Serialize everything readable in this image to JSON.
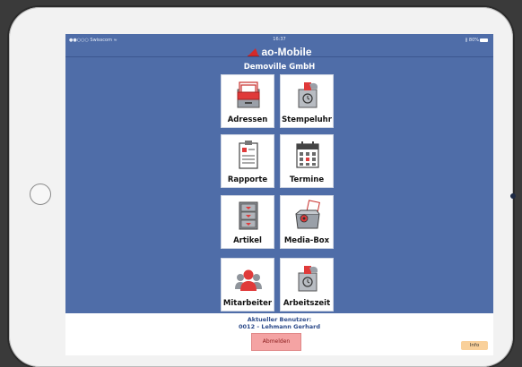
{
  "status_bar": {
    "carrier": "●●○○○ Swisscom ≈",
    "time": "16:37",
    "battery": "∦ 80%"
  },
  "app": {
    "title": "ao-Mobile",
    "brand_color": "#d42a2a"
  },
  "company": "Demoville GmbH",
  "tiles": [
    {
      "label": "Adressen",
      "icon": "address-drawer-icon"
    },
    {
      "label": "Stempeluhr",
      "icon": "time-clock-icon"
    },
    {
      "label": "Rapporte",
      "icon": "clipboard-icon"
    },
    {
      "label": "Termine",
      "icon": "calendar-icon"
    },
    {
      "label": "Artikel",
      "icon": "cabinet-icon"
    },
    {
      "label": "Media-Box",
      "icon": "media-box-icon"
    },
    {
      "label": "Mitarbeiter",
      "icon": "employees-icon"
    },
    {
      "label": "Arbeitszeit",
      "icon": "work-time-icon"
    }
  ],
  "footer": {
    "caption": "Aktueller Benutzer:",
    "user": "0012 - Lehmann Gerhard",
    "logout_label": "Abmelden",
    "info_label": "Info"
  }
}
